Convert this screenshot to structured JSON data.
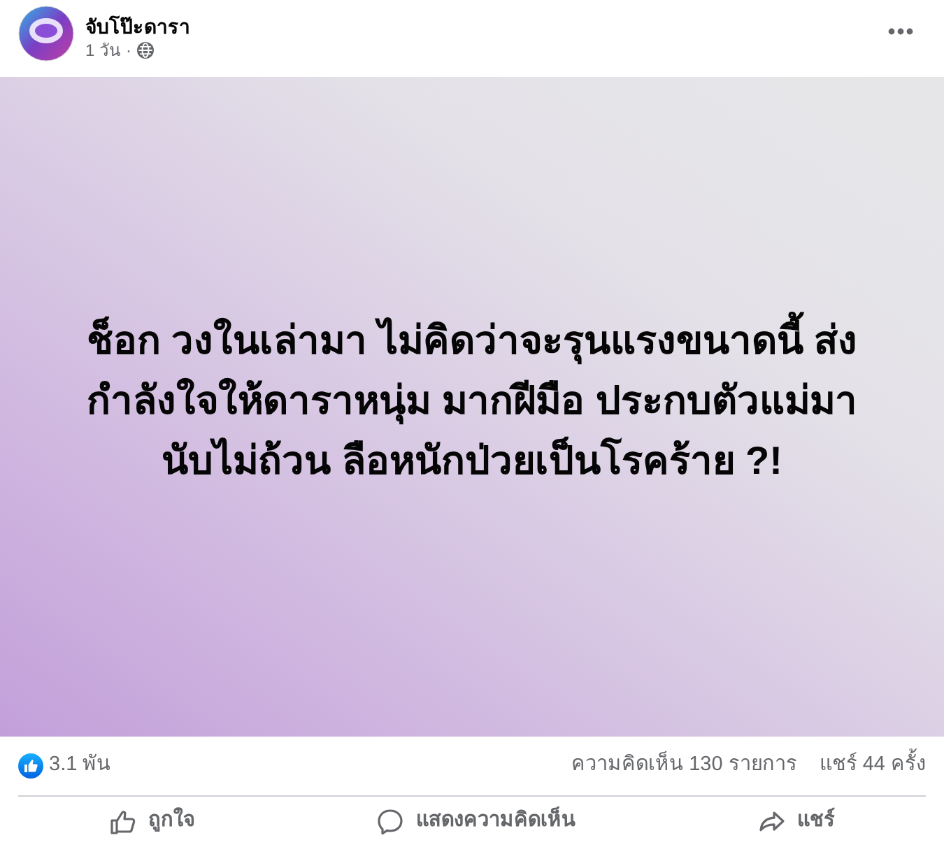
{
  "post_header": {
    "page_name": "จับโป๊ะดารา",
    "time": "1 วัน",
    "separator": "·"
  },
  "post_text": "ช็อก วงในเล่ามา ไม่คิดว่าจะรุนแรงขนาดนี้ ส่งกำลังใจให้ดาราหนุ่ม มากฝีมือ ประกบตัวแม่มา นับไม่ถ้วน ลือหนักป่วยเป็นโรคร้าย ?!",
  "stats": {
    "reactions": "3.1 พัน",
    "comments": "ความคิดเห็น 130 รายการ",
    "shares": "แชร์ 44 ครั้ง"
  },
  "actions": [
    {
      "kind": "like",
      "label": "ถูกใจ"
    },
    {
      "kind": "comment",
      "label": "แสดงความคิดเห็น"
    },
    {
      "kind": "share",
      "label": "แชร์"
    }
  ]
}
